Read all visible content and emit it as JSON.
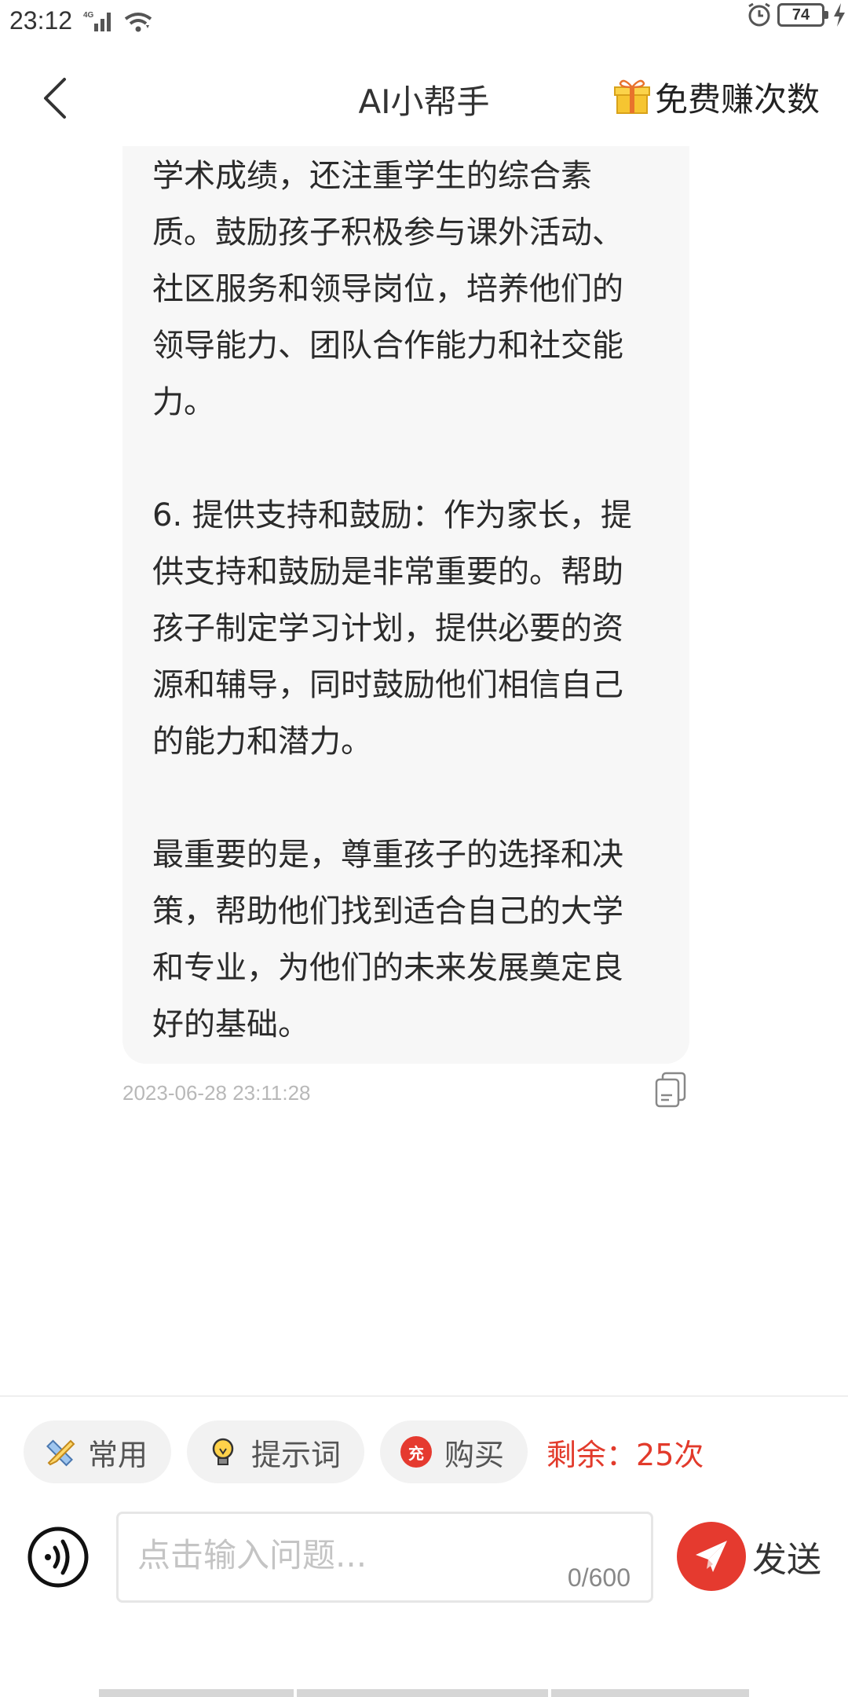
{
  "status_bar": {
    "time": "23:12",
    "network": "4G",
    "battery": "74",
    "icons": [
      "signal-icon",
      "wifi-icon",
      "alarm-icon",
      "battery-icon",
      "charging-icon"
    ]
  },
  "header": {
    "title": "AI小帮手",
    "back_icon": "chevron-left-icon",
    "earn_label": "免费赚次数",
    "earn_icon": "gift-icon"
  },
  "message": {
    "text": "学术成绩，还注重学生的综合素\n质。鼓励孩子积极参与课外活动、\n社区服务和领导岗位，培养他们的\n领导能力、团队合作能力和社交能\n力。\n\n6. 提供支持和鼓励：作为家长，提\n供支持和鼓励是非常重要的。帮助\n孩子制定学习计划，提供必要的资\n源和辅导，同时鼓励他们相信自己\n的能力和潜力。\n\n最重要的是，尊重孩子的选择和决\n策，帮助他们找到适合自己的大学\n和专业，为他们的未来发展奠定良\n好的基础。",
    "timestamp": "2023-06-28 23:11:28",
    "copy_icon": "copy-icon"
  },
  "toolbar": {
    "common_label": "常用",
    "prompt_label": "提示词",
    "buy_label": "购买",
    "buy_badge": "充",
    "remaining": "剩余：25次"
  },
  "composer": {
    "placeholder": "点击输入问题...",
    "char_count": "0/600",
    "send_label": "发送",
    "voice_icon": "voice-icon",
    "send_icon": "paper-plane-icon"
  },
  "colors": {
    "accent": "#e53a2f",
    "bubble_bg": "#f7f7f7",
    "chip_bg": "#f2f2f2"
  }
}
